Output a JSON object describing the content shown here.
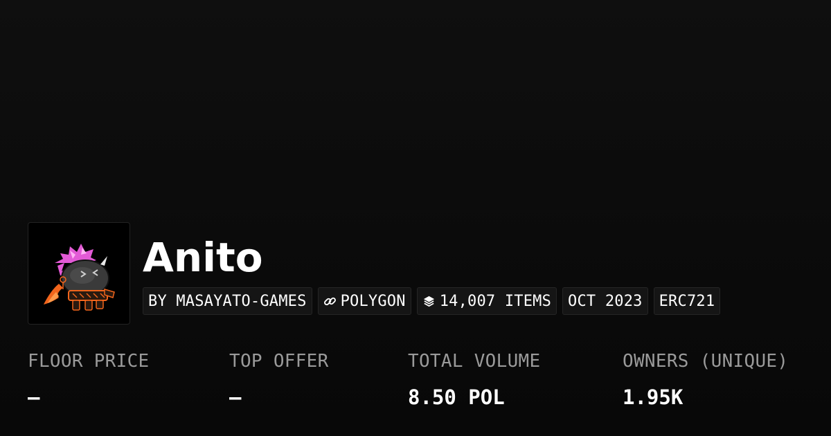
{
  "collection": {
    "name": "Anito",
    "avatar_icon": "anito-creature-avatar"
  },
  "tags": [
    {
      "label": "BY MASAYATO-GAMES",
      "icon": null
    },
    {
      "label": "POLYGON",
      "icon": "chain-link-icon"
    },
    {
      "label": "14,007 ITEMS",
      "icon": "layers-icon"
    },
    {
      "label": "OCT 2023",
      "icon": null
    },
    {
      "label": "ERC721",
      "icon": null
    }
  ],
  "stats": [
    {
      "label": "FLOOR PRICE",
      "value": "–"
    },
    {
      "label": "TOP OFFER",
      "value": "–"
    },
    {
      "label": "TOTAL VOLUME",
      "value": "8.50 POL"
    },
    {
      "label": "OWNERS (UNIQUE)",
      "value": "1.95K"
    }
  ],
  "colors": {
    "background": "#0b0b0b",
    "text_primary": "#ffffff",
    "text_muted": "#9a9a9a",
    "tag_background": "#151515",
    "avatar_accent_pink": "#e35ad6",
    "avatar_accent_orange": "#f2651c"
  }
}
